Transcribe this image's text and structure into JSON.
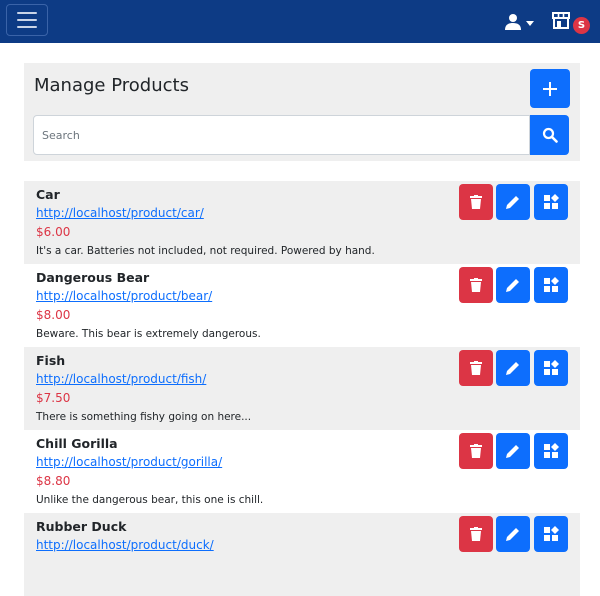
{
  "navbar": {
    "menu_icon": "hamburger-menu-icon",
    "user_icon": "user-icon",
    "store_icon": "storefront-icon",
    "badge_text": "S",
    "background_color": "#0d3b85"
  },
  "header": {
    "title": "Manage Products",
    "add_icon": "plus-icon",
    "search_placeholder": "Search",
    "search_icon": "search-icon"
  },
  "actions": {
    "delete_icon": "trash-icon",
    "edit_icon": "pencil-icon",
    "manage_icon": "grid-plus-icon"
  },
  "colors": {
    "primary": "#0d6efd",
    "danger": "#dc3545",
    "row_shade": "#efefef"
  },
  "products": [
    {
      "name": "Car",
      "url": "http://localhost/product/car/",
      "price": "$6.00",
      "description": "It's a car. Batteries not included, not required. Powered by hand."
    },
    {
      "name": "Dangerous Bear",
      "url": "http://localhost/product/bear/",
      "price": "$8.00",
      "description": "Beware. This bear is extremely dangerous."
    },
    {
      "name": "Fish",
      "url": "http://localhost/product/fish/",
      "price": "$7.50",
      "description": "There is something fishy going on here..."
    },
    {
      "name": "Chill Gorilla",
      "url": "http://localhost/product/gorilla/",
      "price": "$8.80",
      "description": "Unlike the dangerous bear, this one is chill."
    },
    {
      "name": "Rubber Duck",
      "url": "http://localhost/product/duck/",
      "price": "",
      "description": ""
    }
  ]
}
